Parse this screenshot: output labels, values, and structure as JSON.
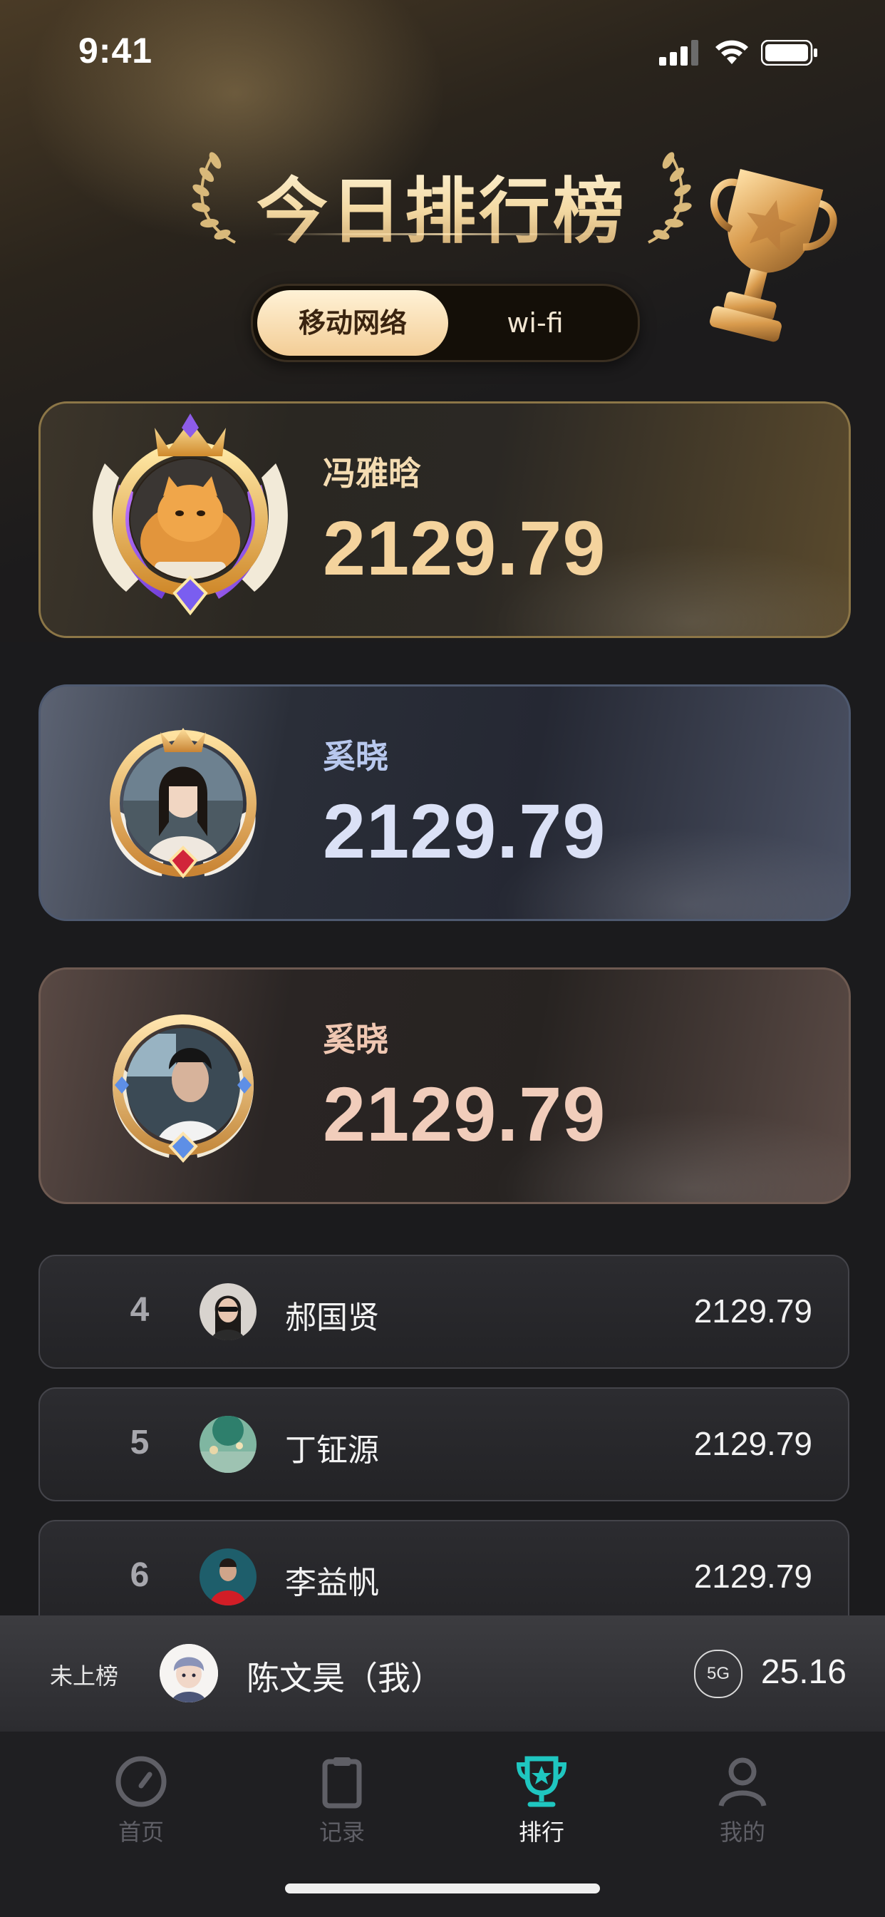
{
  "status": {
    "time": "9:41"
  },
  "header": {
    "title": "今日排行榜"
  },
  "segment": {
    "options": [
      "移动网络",
      "wi-fi"
    ],
    "selected": "移动网络"
  },
  "podium": [
    {
      "rank": 1,
      "name": "冯雅晗",
      "score": "2129.79"
    },
    {
      "rank": 2,
      "name": "奚晓",
      "score": "2129.79"
    },
    {
      "rank": 3,
      "name": "奚晓",
      "score": "2129.79"
    }
  ],
  "list": [
    {
      "rank": "4",
      "name": "郝国贤",
      "score": "2129.79"
    },
    {
      "rank": "5",
      "name": "丁钲源",
      "score": "2129.79"
    },
    {
      "rank": "6",
      "name": "李益帆",
      "score": "2129.79"
    }
  ],
  "me": {
    "label": "未上榜",
    "name": "陈文昊（我）",
    "network": "5G",
    "value": "25.16"
  },
  "tabs": [
    {
      "label": "首页",
      "icon": "speedometer-icon"
    },
    {
      "label": "记录",
      "icon": "clipboard-icon"
    },
    {
      "label": "排行",
      "icon": "trophy-icon",
      "active": true
    },
    {
      "label": "我的",
      "icon": "person-icon"
    }
  ],
  "colors": {
    "accent": "#1fc6c0",
    "gold": "#f4d39d",
    "silver": "#dbe1f6",
    "bronze": "#f1cdbb"
  }
}
